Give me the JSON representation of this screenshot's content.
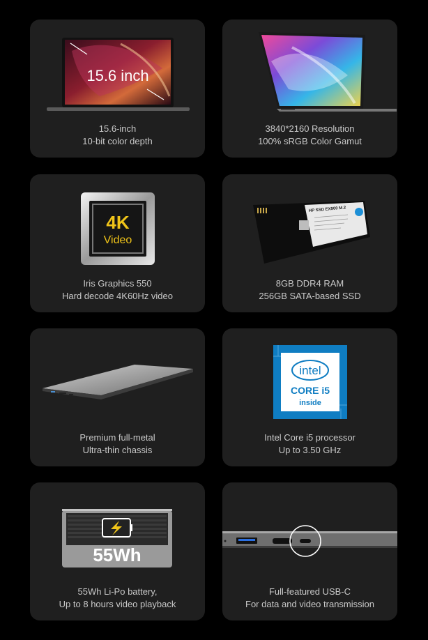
{
  "cards": [
    {
      "line1": "15.6-inch",
      "line2": "10-bit color depth",
      "overlay": "15.6 inch"
    },
    {
      "line1": "3840*2160 Resolution",
      "line2": "100% sRGB Color Gamut"
    },
    {
      "line1": "Iris Graphics 550",
      "line2": "Hard decode 4K60Hz video",
      "chip_top": "4K",
      "chip_bottom": "Video"
    },
    {
      "line1": "8GB DDR4 RAM",
      "line2": "256GB SATA-based SSD",
      "ssd_label": "HP SSD EX900 M.2"
    },
    {
      "line1": "Premium full-metal",
      "line2": "Ultra-thin chassis"
    },
    {
      "line1": "Intel Core i5 processor",
      "line2": "Up to 3.50 GHz",
      "intel_brand": "intel",
      "intel_core": "CORE i5",
      "intel_inside": "inside"
    },
    {
      "line1": "55Wh Li-Po battery,",
      "line2": "Up to 8 hours video playback",
      "battery_label": "55Wh"
    },
    {
      "line1": "Full-featured USB-C",
      "line2": "For data and video transmission"
    }
  ],
  "colors": {
    "background": "#000000",
    "card": "#1f1f1f",
    "caption": "#c9c9c9",
    "intel_blue": "#0f7dc2"
  }
}
